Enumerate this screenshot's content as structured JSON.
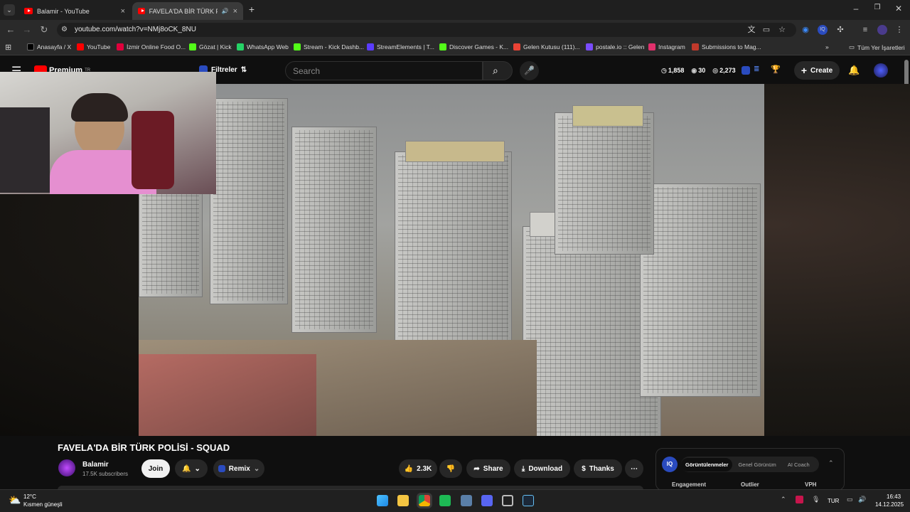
{
  "tabs": [
    {
      "title": "Balamir - YouTube"
    },
    {
      "title": "FAVELA'DA BİR TÜRK POLİS"
    }
  ],
  "address": {
    "url": "youtube.com/watch?v=NMj8oCK_8NU"
  },
  "bookmarks": [
    {
      "label": "Anasayfa / X",
      "color": "#000000"
    },
    {
      "label": "YouTube",
      "color": "#ff0000"
    },
    {
      "label": "İzmir Online Food O...",
      "color": "#e0003c"
    },
    {
      "label": "Gözat | Kick",
      "color": "#53fc18"
    },
    {
      "label": "WhatsApp Web",
      "color": "#25d366"
    },
    {
      "label": "Stream - Kick Dashb...",
      "color": "#53fc18"
    },
    {
      "label": "StreamElements | T...",
      "color": "#5b3cff"
    },
    {
      "label": "Discover Games - K...",
      "color": "#53fc18"
    },
    {
      "label": "Gelen Kutusu (111)...",
      "color": "#ea4335"
    },
    {
      "label": "postale.io :: Gelen",
      "color": "#7a4cff"
    },
    {
      "label": "Instagram",
      "color": "#e1306c"
    },
    {
      "label": "Submissions to Mag...",
      "color": "#c0392b"
    }
  ],
  "bookmarks_all": "Tüm Yer İşaretleri",
  "youtube": {
    "logo_text": "Premium",
    "logo_sup": "TR",
    "filters_label": "Filtreler",
    "search_placeholder": "Search",
    "stats": {
      "views": "1,858",
      "eye": "30",
      "count": "2,273"
    },
    "create_label": "Create"
  },
  "video": {
    "title": "FAVELA'DA BİR TÜRK POLİSİ - SQUAD",
    "channel": "Balamir",
    "subscribers": "17.5K subscribers",
    "join_label": "Join",
    "remix_label": "Remix",
    "likes": "2.3K",
    "share_label": "Share",
    "download_label": "Download",
    "thanks_label": "Thanks"
  },
  "iq_panel": {
    "tabs": [
      "Görüntülenmeler",
      "Genel Görünüm",
      "AI Coach"
    ],
    "columns": [
      "Engagement",
      "Outlier",
      "VPH"
    ]
  },
  "taskbar": {
    "temp": "12°C",
    "weather": "Kısmen güneşli",
    "lang": "TUR",
    "time": "16:43",
    "date": "14.12.2025"
  }
}
